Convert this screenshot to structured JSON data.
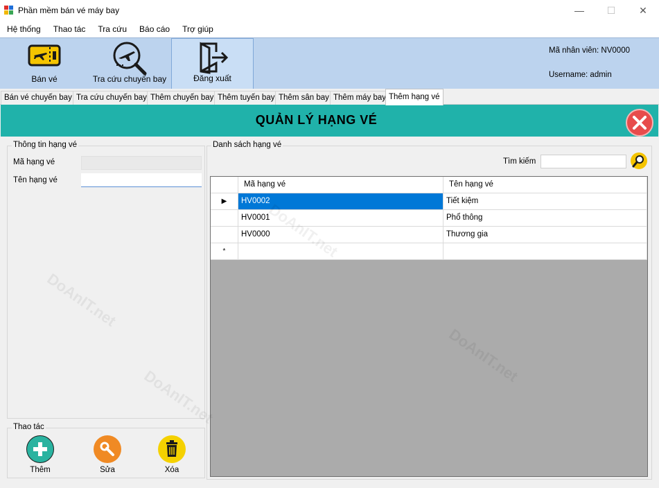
{
  "window": {
    "title": "Phần mềm bán vé máy bay",
    "minimize_glyph": "—",
    "maximize_glyph": "☐",
    "close_glyph": "✕"
  },
  "menu": [
    "Hệ thống",
    "Thao tác",
    "Tra cứu",
    "Báo cáo",
    "Trợ giúp"
  ],
  "toolbar": {
    "buttons": [
      {
        "label": "Bán vé",
        "icon": "ticket-icon"
      },
      {
        "label": "Tra cứu chuyến bay",
        "icon": "flight-search-icon"
      },
      {
        "label": "Đăng xuất",
        "icon": "logout-door-icon"
      }
    ],
    "employee_id": "Mã nhân viên: NV0000",
    "username": "Username: admin"
  },
  "tabs": [
    "Bán vé chuyến bay",
    "Tra cứu chuyến bay",
    "Thêm chuyến bay",
    "Thêm tuyến bay",
    "Thêm sân bay",
    "Thêm máy bay",
    "Thêm hạng vé"
  ],
  "selected_tab": "Thêm hạng vé",
  "header": {
    "title": "QUẢN LÝ HẠNG VÉ",
    "close_icon": "close-x-icon",
    "accent_color": "#20b2aa"
  },
  "info_group": {
    "legend": "Thông tin hạng vé",
    "code_label": "Mã hạng vé",
    "code_value": "",
    "name_label": "Tên hạng vé",
    "name_value": ""
  },
  "actions_group": {
    "legend": "Thao tác",
    "add_label": "Thêm",
    "edit_label": "Sửa",
    "delete_label": "Xóa",
    "add_color": "#2ab3a0",
    "edit_color": "#f08a24",
    "delete_color": "#f5d100"
  },
  "list_group": {
    "legend": "Danh sách hạng vé",
    "search_label": "Tìm kiếm",
    "search_value": ""
  },
  "grid": {
    "columns": [
      "Mã hạng vé",
      "Tên hạng vé"
    ],
    "rows": [
      {
        "code": "HV0002",
        "name": "Tiết kiệm"
      },
      {
        "code": "HV0001",
        "name": "Phổ thông"
      },
      {
        "code": "HV0000",
        "name": "Thương gia"
      }
    ],
    "current_marker": "▶",
    "new_marker": "*",
    "selection_color": "#0078d7"
  },
  "watermark": "DoAnIT.net"
}
